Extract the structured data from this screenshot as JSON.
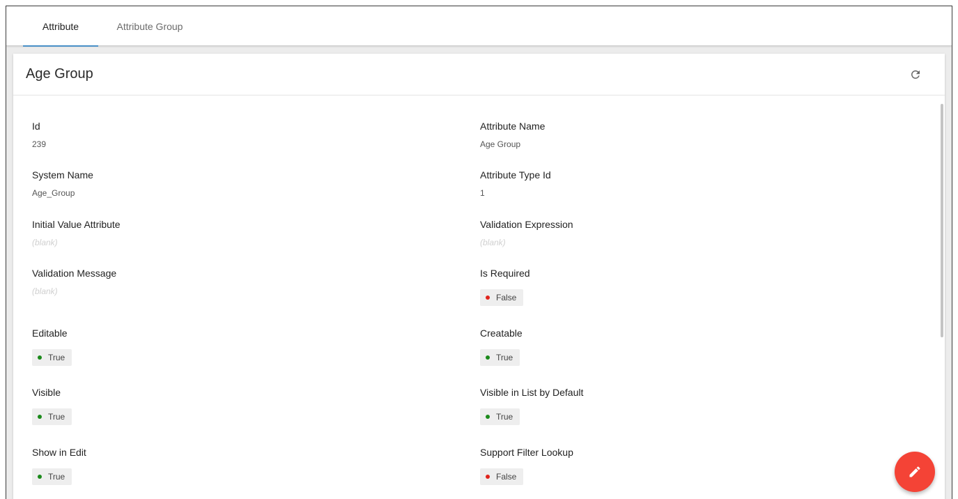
{
  "tabs": [
    {
      "label": "Attribute",
      "active": true
    },
    {
      "label": "Attribute Group",
      "active": false
    }
  ],
  "card": {
    "title": "Age Group",
    "refresh_icon": "refresh-icon"
  },
  "fields": {
    "id": {
      "label": "Id",
      "value": "239"
    },
    "attribute_name": {
      "label": "Attribute Name",
      "value": "Age Group"
    },
    "system_name": {
      "label": "System Name",
      "value": "Age_Group"
    },
    "attribute_type_id": {
      "label": "Attribute Type Id",
      "value": "1"
    },
    "initial_value_attribute": {
      "label": "Initial Value Attribute",
      "value": "(blank)"
    },
    "validation_expression": {
      "label": "Validation Expression",
      "value": "(blank)"
    },
    "validation_message": {
      "label": "Validation Message",
      "value": "(blank)"
    },
    "is_required": {
      "label": "Is Required",
      "value": "False"
    },
    "editable": {
      "label": "Editable",
      "value": "True"
    },
    "creatable": {
      "label": "Creatable",
      "value": "True"
    },
    "visible": {
      "label": "Visible",
      "value": "True"
    },
    "visible_in_list": {
      "label": "Visible in List by Default",
      "value": "True"
    },
    "show_in_edit": {
      "label": "Show in Edit",
      "value": "True"
    },
    "support_filter_lookup": {
      "label": "Support Filter Lookup",
      "value": "False"
    }
  },
  "fab": {
    "icon": "pencil-icon"
  },
  "colors": {
    "true_dot": "#1b8a1b",
    "false_dot": "#e0241c",
    "fab": "#f44336",
    "tab_indicator": "#4a90c8"
  }
}
